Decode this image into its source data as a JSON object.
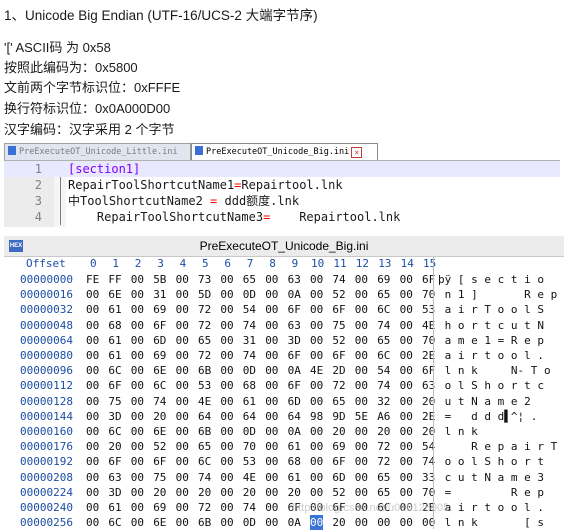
{
  "notes": [
    "1、Unicode Big Endian (UTF-16/UCS-2 大端字节序)",
    "'[' ASCII码 为  0x58",
    "按照此编码为：0x5800",
    "文前两个字节标识位：0xFFFE",
    "换行符标识位：0x0A000D00",
    "汉字编码：汉字采用 2 个字节"
  ],
  "editor": {
    "tabs": [
      {
        "label": "PreExecuteOT_Unicode_Little.ini",
        "active": false
      },
      {
        "label": "PreExecuteOT_Unicode_Big.ini",
        "active": true
      }
    ],
    "lines": [
      {
        "num": "1",
        "parts": [
          "",
          "[section1]",
          ""
        ]
      },
      {
        "num": "2",
        "parts": [
          "RepairToolShortcutName1",
          "=",
          "Repairtool.lnk"
        ]
      },
      {
        "num": "3",
        "parts": [
          "中ToolShortcutName2 ",
          "=",
          " ddd额度.lnk"
        ]
      },
      {
        "num": "4",
        "parts": [
          "    RepairToolShortcutName3",
          "=",
          "    Repairtool.lnk"
        ]
      }
    ]
  },
  "hex": {
    "title": "PreExecuteOT_Unicode_Big.ini",
    "offset_label": "Offset",
    "columns": [
      "0",
      "1",
      "2",
      "3",
      "4",
      "5",
      "6",
      "7",
      "8",
      "9",
      "10",
      "11",
      "12",
      "13",
      "14",
      "15"
    ],
    "rows": [
      {
        "offset": "00000000",
        "bytes": [
          "FE",
          "FF",
          "00",
          "5B",
          "00",
          "73",
          "00",
          "65",
          "00",
          "63",
          "00",
          "74",
          "00",
          "69",
          "00",
          "6F"
        ],
        "ascii": "þÿ [ s e c t i o"
      },
      {
        "offset": "00000016",
        "bytes": [
          "00",
          "6E",
          "00",
          "31",
          "00",
          "5D",
          "00",
          "0D",
          "00",
          "0A",
          "00",
          "52",
          "00",
          "65",
          "00",
          "70"
        ],
        "ascii": " n 1 ]       R e p"
      },
      {
        "offset": "00000032",
        "bytes": [
          "00",
          "61",
          "00",
          "69",
          "00",
          "72",
          "00",
          "54",
          "00",
          "6F",
          "00",
          "6F",
          "00",
          "6C",
          "00",
          "53"
        ],
        "ascii": " a i r T o o l S"
      },
      {
        "offset": "00000048",
        "bytes": [
          "00",
          "68",
          "00",
          "6F",
          "00",
          "72",
          "00",
          "74",
          "00",
          "63",
          "00",
          "75",
          "00",
          "74",
          "00",
          "4E"
        ],
        "ascii": " h o r t c u t N"
      },
      {
        "offset": "00000064",
        "bytes": [
          "00",
          "61",
          "00",
          "6D",
          "00",
          "65",
          "00",
          "31",
          "00",
          "3D",
          "00",
          "52",
          "00",
          "65",
          "00",
          "70"
        ],
        "ascii": " a m e 1 = R e p"
      },
      {
        "offset": "00000080",
        "bytes": [
          "00",
          "61",
          "00",
          "69",
          "00",
          "72",
          "00",
          "74",
          "00",
          "6F",
          "00",
          "6F",
          "00",
          "6C",
          "00",
          "2E"
        ],
        "ascii": " a i r t o o l ."
      },
      {
        "offset": "00000096",
        "bytes": [
          "00",
          "6C",
          "00",
          "6E",
          "00",
          "6B",
          "00",
          "0D",
          "00",
          "0A",
          "4E",
          "2D",
          "00",
          "54",
          "00",
          "6F"
        ],
        "ascii": " l n k     N- T o"
      },
      {
        "offset": "00000112",
        "bytes": [
          "00",
          "6F",
          "00",
          "6C",
          "00",
          "53",
          "00",
          "68",
          "00",
          "6F",
          "00",
          "72",
          "00",
          "74",
          "00",
          "63"
        ],
        "ascii": " o l S h o r t c"
      },
      {
        "offset": "00000128",
        "bytes": [
          "00",
          "75",
          "00",
          "74",
          "00",
          "4E",
          "00",
          "61",
          "00",
          "6D",
          "00",
          "65",
          "00",
          "32",
          "00",
          "20"
        ],
        "ascii": " u t N a m e 2"
      },
      {
        "offset": "00000144",
        "bytes": [
          "00",
          "3D",
          "00",
          "20",
          "00",
          "64",
          "00",
          "64",
          "00",
          "64",
          "98",
          "9D",
          "5E",
          "A6",
          "00",
          "2E"
        ],
        "ascii": " =   d d d▌^¦ ."
      },
      {
        "offset": "00000160",
        "bytes": [
          "00",
          "6C",
          "00",
          "6E",
          "00",
          "6B",
          "00",
          "0D",
          "00",
          "0A",
          "00",
          "20",
          "00",
          "20",
          "00",
          "20"
        ],
        "ascii": " l n k"
      },
      {
        "offset": "00000176",
        "bytes": [
          "00",
          "20",
          "00",
          "52",
          "00",
          "65",
          "00",
          "70",
          "00",
          "61",
          "00",
          "69",
          "00",
          "72",
          "00",
          "54"
        ],
        "ascii": "     R e p a i r T"
      },
      {
        "offset": "00000192",
        "bytes": [
          "00",
          "6F",
          "00",
          "6F",
          "00",
          "6C",
          "00",
          "53",
          "00",
          "68",
          "00",
          "6F",
          "00",
          "72",
          "00",
          "74"
        ],
        "ascii": " o o l S h o r t"
      },
      {
        "offset": "00000208",
        "bytes": [
          "00",
          "63",
          "00",
          "75",
          "00",
          "74",
          "00",
          "4E",
          "00",
          "61",
          "00",
          "6D",
          "00",
          "65",
          "00",
          "33"
        ],
        "ascii": " c u t N a m e 3"
      },
      {
        "offset": "00000224",
        "bytes": [
          "00",
          "3D",
          "00",
          "20",
          "00",
          "20",
          "00",
          "20",
          "00",
          "20",
          "00",
          "52",
          "00",
          "65",
          "00",
          "70"
        ],
        "ascii": " =         R e p"
      },
      {
        "offset": "00000240",
        "bytes": [
          "00",
          "61",
          "00",
          "69",
          "00",
          "72",
          "00",
          "74",
          "00",
          "6F",
          "00",
          "6F",
          "00",
          "6C",
          "00",
          "2E"
        ],
        "ascii": " a i r t o o l ."
      },
      {
        "offset": "00000256",
        "bytes": [
          "00",
          "6C",
          "00",
          "6E",
          "00",
          "6B",
          "00",
          "0D",
          "00",
          "0A",
          "00",
          "20",
          "00",
          "00",
          "00",
          "00"
        ],
        "ascii": " l n k       [ s"
      }
    ],
    "selected": {
      "row": 16,
      "col": 10
    }
  },
  "watermark": "http://blog.csdn.net/u010126005",
  "colors": {
    "offset": "#1c4ea6",
    "selection": "#3b74d8",
    "section": "#8000ff",
    "operator": "#ff0000"
  }
}
